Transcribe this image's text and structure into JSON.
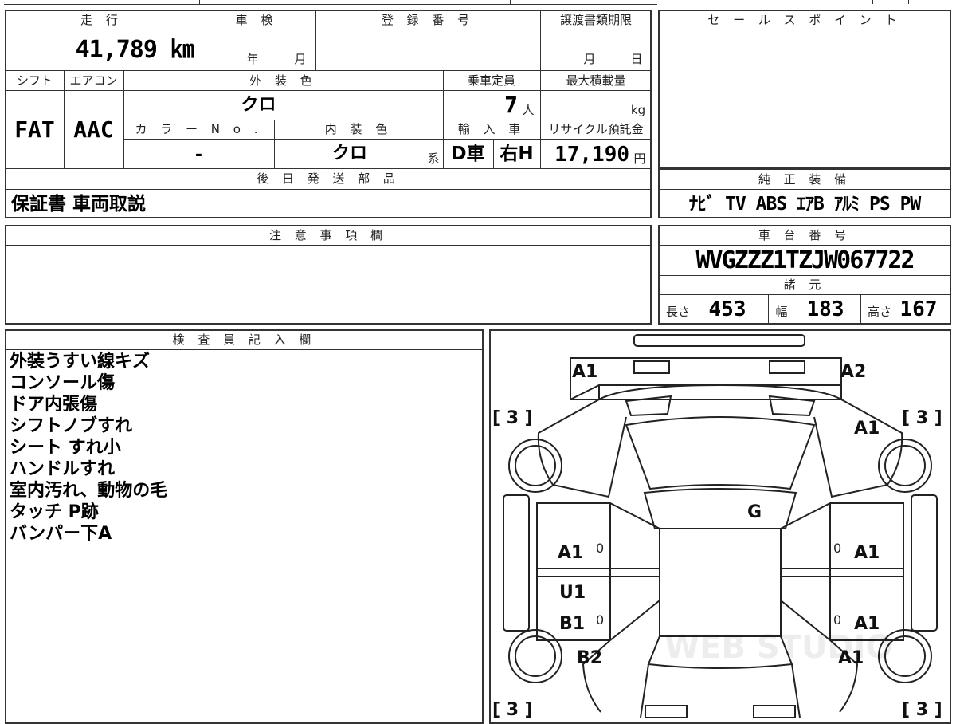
{
  "headers": {
    "mileage": "走 行",
    "inspection": "車 検",
    "registration_no": "登 録 番 号",
    "transfer_deadline": "譲渡書類期限",
    "sale_point": "セ ー ル ス ポ イ ン ト",
    "shift": "シフト",
    "aircon": "エアコン",
    "exterior_color": "外 装 色",
    "capacity": "乗車定員",
    "max_load": "最大積載量",
    "color_no": "カ ラ ー N o .",
    "interior_color": "内 装 色",
    "import": "輸 入 車",
    "recycle": "リサイクル預託金",
    "later_parts": "後 日 発 送 部 品",
    "genuine_equipment": "純 正 装 備",
    "notes": "注 意 事 項 欄",
    "chassis_no": "車 台 番 号",
    "specs": "諸 元",
    "inspector": "検 査 員 記 入 欄"
  },
  "values": {
    "mileage": "41,789 ㎞",
    "inspection_year_unit": "年",
    "inspection_month_unit": "月",
    "deadline_month_unit": "月",
    "deadline_day_unit": "日",
    "shift": "FAT",
    "aircon": "AAC",
    "exterior_color": "クロ",
    "capacity": "7",
    "capacity_unit": "人",
    "max_load_unit": "kg",
    "color_no": "-",
    "interior_color": "クロ",
    "interior_suffix": "系",
    "import_type": "D車",
    "steering": "右H",
    "recycle": "17,190",
    "recycle_unit": "円",
    "later_parts": "保証書 車両取説",
    "genuine_equipment": "ﾅﾋﾞ TV ABS ｴｱB ｱﾙﾐ PS PW",
    "chassis_no": "WVGZZZ1TZJW067722",
    "length_label": "長さ",
    "length": "453",
    "width_label": "幅",
    "width": "183",
    "height_label": "高さ",
    "height": "167"
  },
  "inspector_comments": [
    "外装うすい線キズ",
    "コンソール傷",
    "ドア内張傷",
    "シフトノブすれ",
    "シート すれ小",
    "ハンドルすれ",
    "室内汚れ、動物の毛",
    "タッチ P跡",
    "バンパー下A"
  ],
  "diagram": {
    "watermark": "WEB STUDIO",
    "tire_marks": {
      "front_left": "[ 3 ]",
      "front_right": "[ 3 ]",
      "rear_left": "[ 3 ]",
      "rear_right": "[ 3 ]"
    },
    "damage_codes": {
      "front_bumper_left": "A1",
      "front_bumper_right": "A2",
      "right_front_fender": "A1",
      "windshield": "G",
      "left_front_door": "A1",
      "right_front_door": "A1",
      "left_rear_door_upper": "U1",
      "left_rear_door": "B1",
      "right_rear_door": "A1",
      "left_rear_fender": "B2",
      "right_rear_fender": "A1",
      "door_marks": [
        "0",
        "0",
        "0",
        "0"
      ]
    }
  }
}
